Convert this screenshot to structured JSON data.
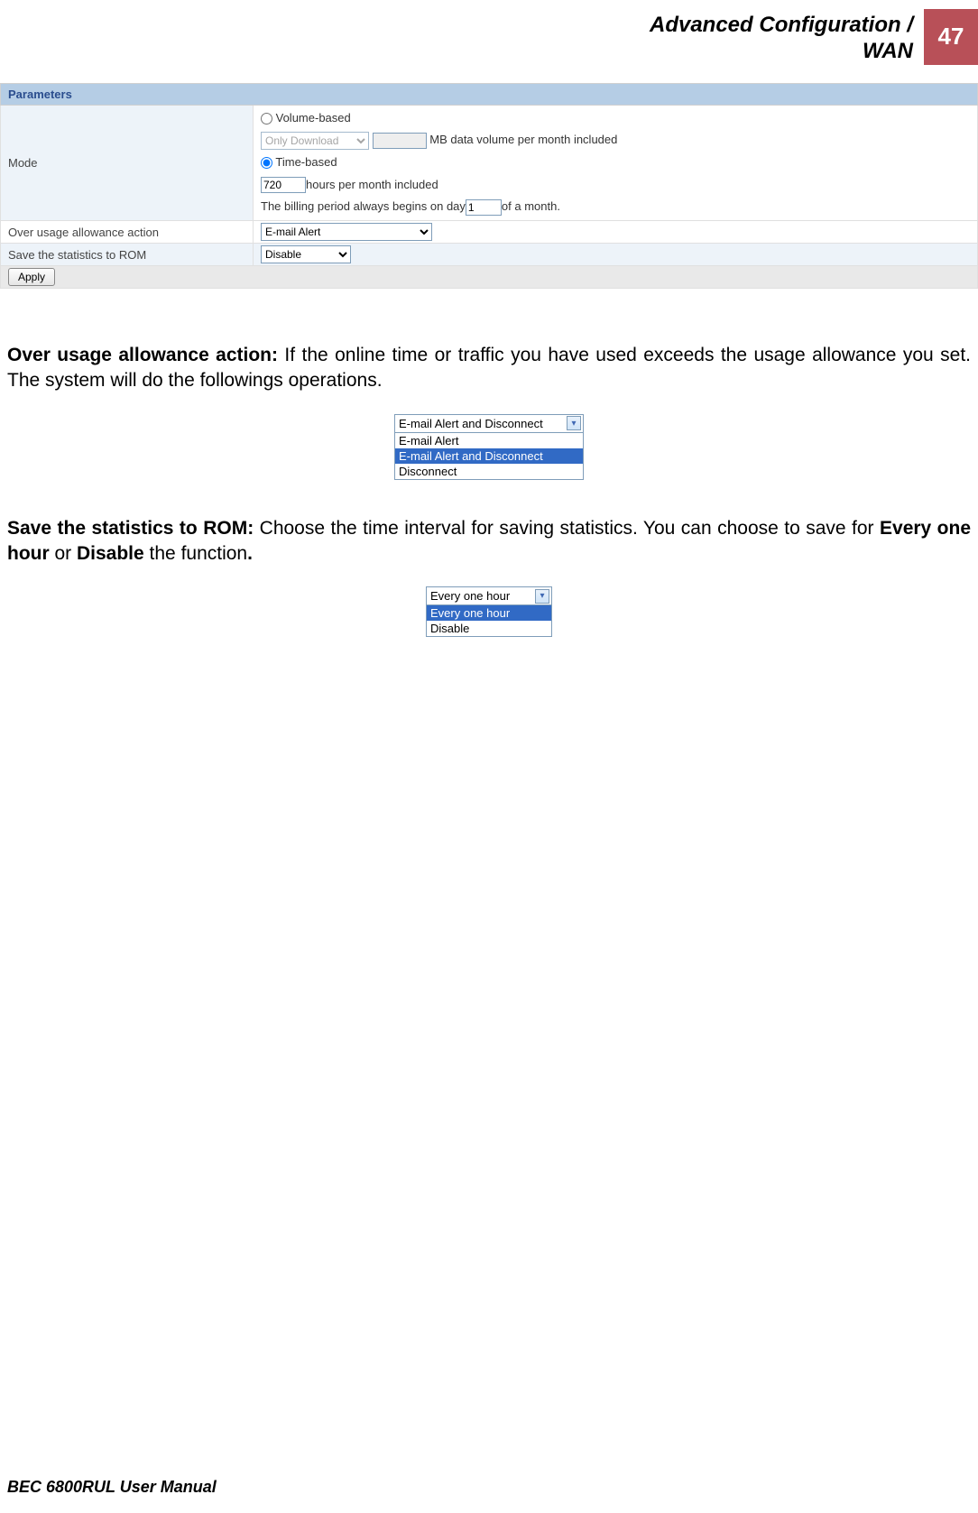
{
  "header": {
    "title_line1": "Advanced Configuration /",
    "title_line2": "WAN",
    "page_number": "47"
  },
  "params_table": {
    "header": "Parameters",
    "rows": {
      "mode": {
        "label": "Mode",
        "volume_radio_label": "Volume-based",
        "download_select": "Only Download",
        "mb_value": "",
        "mb_suffix": "MB data volume per month included",
        "time_radio_label": "Time-based",
        "hours_value": "720",
        "hours_suffix": "hours per month included",
        "billing_prefix": "The billing period always begins on day",
        "billing_day": "1",
        "billing_suffix": "of a month."
      },
      "over_usage": {
        "label": "Over usage allowance action",
        "select": "E-mail Alert"
      },
      "save_stats": {
        "label": "Save the statistics to ROM",
        "select": "Disable"
      }
    },
    "apply": "Apply"
  },
  "section1": {
    "bold": "Over usage allowance action:",
    "rest": " If the online time or traffic you have used exceeds the usage allowance you set. The system will do the followings operations."
  },
  "fig1": {
    "selected": "E-mail Alert and Disconnect",
    "options": [
      "E-mail Alert",
      "E-mail Alert and Disconnect",
      "Disconnect"
    ],
    "highlight_index": 1
  },
  "section2": {
    "bold1": "Save the statistics to ROM:",
    "mid1": " Choose the time interval for saving statistics. You can choose to save for ",
    "bold2": "Every one hour",
    "mid2": " or ",
    "bold3": "Disable",
    "mid3": " the function",
    "bold4": "."
  },
  "fig2": {
    "selected": "Every one hour",
    "options": [
      "Every one hour",
      "Disable"
    ],
    "highlight_index": 0
  },
  "footer": "BEC 6800RUL User Manual"
}
